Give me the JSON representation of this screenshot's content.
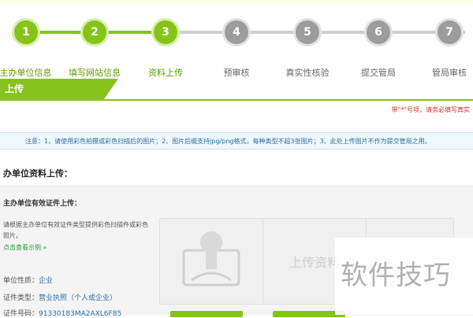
{
  "steps": [
    {
      "num": "1",
      "label": "写主办单位信息",
      "state": "done"
    },
    {
      "num": "2",
      "label": "填写网站信息",
      "state": "done"
    },
    {
      "num": "3",
      "label": "资料上传",
      "state": "done"
    },
    {
      "num": "4",
      "label": "预审核",
      "state": "todo"
    },
    {
      "num": "5",
      "label": "真实性核验",
      "state": "todo"
    },
    {
      "num": "6",
      "label": "提交管局",
      "state": "todo"
    },
    {
      "num": "7",
      "label": "管局审核",
      "state": "todo"
    }
  ],
  "section": {
    "tab_label": "上传",
    "required_note": "带\"*\"号项，请务必填写真实",
    "notice": "注意：1、请使用彩色拍摄或彩色扫描后的图片；2、图片后缀支持jpg/png格式，每种类型不超3张图片；3、此处上传图片不作为提交管局之用。",
    "subtitle": "办单位资料上传："
  },
  "panel": {
    "title": "主办单位有效证件上传：",
    "description": "请根据主办单位有效证件类型提供彩色扫描件或彩色照片。",
    "example_link": "点击查看示例 »",
    "nature_label": "单位性质：",
    "nature_value": "企业",
    "cert_type_label": "证件类型：",
    "cert_type_value": "营业执照（个人或企业）",
    "cert_no_label": "证件号码：",
    "cert_no_value": "91330183MA2AXL6F85",
    "upload_placeholder": "上传资料"
  },
  "watermark": "软件技巧",
  "colors": {
    "accent": "#86c31a",
    "pending": "#9c9c9c",
    "link": "#2a6fb2",
    "warning": "#d9302a"
  }
}
